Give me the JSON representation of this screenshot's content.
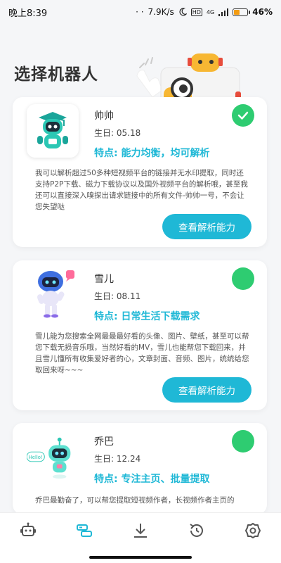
{
  "status_bar": {
    "time": "晚上8:39",
    "net_speed": "7.9K/s",
    "hd_label": "HD",
    "network_label": "4G",
    "battery_level": 0.46,
    "battery_text": "46%"
  },
  "page": {
    "title": "选择机器人"
  },
  "robots": [
    {
      "name": "帅帅",
      "birthday": "生日: 05.18",
      "feature": "特点: 能力均衡，均可解析",
      "description": "我可以解析超过50多种短视频平台的链接并无水印提取，同时还支持P2P下载、磁力下载协议以及国外视频平台的解析哦，甚至我还可以直接深入嗅探出请求链接中的所有文件-帅帅一号，不会让您失望哒",
      "button": "查看解析能力",
      "selected": true
    },
    {
      "name": "雪儿",
      "birthday": "生日: 08.11",
      "feature": "特点: 日常生活下载需求",
      "description": "雪儿能为您搜索全网最最最好看的头像、图片、壁纸，甚至可以帮您下载无损音乐哦，当然好看的MV，雪儿也能帮您下载回来，并且雪儿懂所有收集爱好者的心，文章封面、音频、图片，统统给您取回来呀~~~",
      "button": "查看解析能力",
      "selected": false
    },
    {
      "name": "乔巴",
      "birthday": "生日: 12.24",
      "feature": "特点: 专注主页、批量提取",
      "description": "乔巴最勤奋了，可以帮您提取短视频作者，长视频作者主页的",
      "badge_text": "Hello!",
      "selected": false
    }
  ],
  "nav": {
    "items": [
      "robot-icon",
      "parse-icon",
      "download-icon",
      "history-icon",
      "settings-icon"
    ],
    "active_index": 1
  },
  "colors": {
    "accent": "#1fb8d6",
    "selected": "#2ecc71",
    "nav_active": "#1fb8d6",
    "nav_inactive": "#555555"
  }
}
